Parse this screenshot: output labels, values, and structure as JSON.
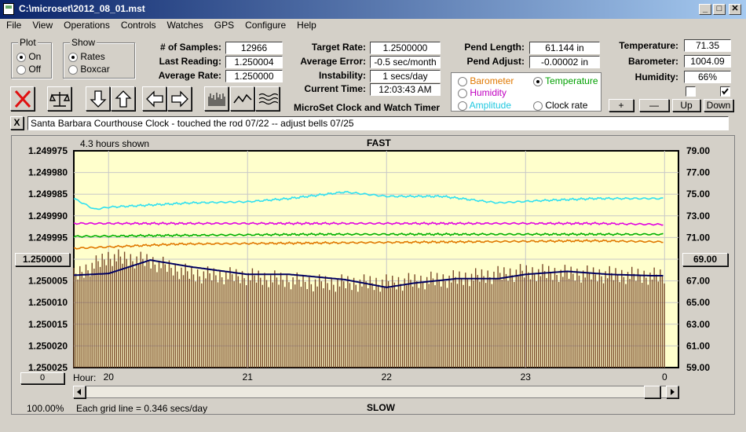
{
  "window": {
    "title": "C:\\microset\\2012_08_01.mst"
  },
  "menu": [
    "File",
    "View",
    "Operations",
    "Controls",
    "Watches",
    "GPS",
    "Configure",
    "Help"
  ],
  "plot_group": {
    "label": "Plot",
    "on": "On",
    "off": "Off",
    "selected": "On"
  },
  "show_group": {
    "label": "Show",
    "rates": "Rates",
    "boxcar": "Boxcar",
    "selected": "Rates"
  },
  "stats": {
    "samples_label": "# of Samples:",
    "samples": "12966",
    "last_reading_label": "Last Reading:",
    "last_reading": "1.250004",
    "average_rate_label": "Average Rate:",
    "average_rate": "1.250000",
    "target_rate_label": "Target Rate:",
    "target_rate": "1.2500000",
    "average_error_label": "Average Error:",
    "average_error": "-0.5 sec/month",
    "instability_label": "Instability:",
    "instability": "1 secs/day",
    "current_time_label": "Current Time:",
    "current_time": "12:03:43 AM",
    "pend_length_label": "Pend Length:",
    "pend_length": "61.144 in",
    "pend_adjust_label": "Pend Adjust:",
    "pend_adjust": "-0.00002 in",
    "temperature_label": "Temperature:",
    "temperature": "71.35",
    "barometer_label": "Barometer:",
    "barometer": "1004.09",
    "humidity_label": "Humidity:",
    "humidity": "66%"
  },
  "app_name": "MicroSet Clock and Watch Timer",
  "sensor_legend": {
    "barometer": "Barometer",
    "temperature": "Temperature",
    "humidity": "Humidity",
    "amplitude": "Amplitude",
    "clock_rate": "Clock rate",
    "selected": "Temperature"
  },
  "scale_buttons": {
    "plus": "+",
    "minus": "—",
    "up": "Up",
    "down": "Down"
  },
  "note": {
    "close": "X",
    "text": "Santa Barbara Courthouse Clock  -  touched the rod 07/22  --  adjust bells 07/25"
  },
  "chart_header": {
    "hours_shown": "4.3 hours shown",
    "top": "FAST",
    "bottom": "SLOW",
    "zoom": "100.00%",
    "grid_note": "Each grid line = 0.346 secs/day",
    "left_ref": "1.250000",
    "right_ref": "69.00",
    "scroll_value": "0"
  },
  "colors": {
    "temperature": "#00b000",
    "barometer": "#e07800",
    "humidity": "#e000e0",
    "amplitude": "#30e0f0",
    "clock_rate": "#000060",
    "bars": "#7a4a2a",
    "plot_bg": "#ffffcc"
  },
  "chart_data": {
    "type": "bar",
    "x_axis_label": "Hour:",
    "x_ticks": [
      "20",
      "21",
      "22",
      "23",
      "0"
    ],
    "left_axis": {
      "ticks": [
        "1.249975",
        "1.249980",
        "1.249985",
        "1.249990",
        "1.249995",
        "1.250000",
        "1.250005",
        "1.250010",
        "1.250015",
        "1.250020",
        "1.250025"
      ],
      "range": [
        1.249975,
        1.250025
      ],
      "inverted": true
    },
    "right_axis": {
      "ticks": [
        "79.00",
        "77.00",
        "75.00",
        "73.00",
        "71.00",
        "69.00",
        "67.00",
        "65.00",
        "63.00",
        "61.00",
        "59.00"
      ],
      "range": [
        59,
        79
      ]
    },
    "x_range": [
      19.75,
      24.1
    ],
    "data_end_hour": 24.0,
    "series": [
      {
        "name": "Amplitude",
        "color": "#30e0f0",
        "x": [
          19.75,
          19.9,
          20.0,
          20.3,
          20.6,
          21.0,
          21.3,
          21.7,
          22.0,
          22.4,
          22.8,
          23.1,
          23.5,
          23.8,
          24.0
        ],
        "y": [
          74.6,
          73.6,
          73.8,
          74.0,
          74.2,
          74.3,
          74.6,
          75.2,
          74.8,
          74.8,
          74.2,
          74.4,
          74.6,
          74.6,
          74.6
        ]
      },
      {
        "name": "Humidity",
        "color": "#e000e0",
        "x": [
          19.75,
          20.5,
          21.5,
          22.5,
          23.5,
          24.0
        ],
        "y": [
          72.3,
          72.3,
          72.3,
          72.3,
          72.3,
          72.2
        ]
      },
      {
        "name": "Temperature",
        "color": "#00b000",
        "x": [
          19.75,
          20.5,
          21.5,
          22.5,
          23.5,
          24.0
        ],
        "y": [
          71.1,
          71.2,
          71.3,
          71.3,
          71.3,
          71.3
        ]
      },
      {
        "name": "Barometer",
        "color": "#e07800",
        "x": [
          19.75,
          20.5,
          21.5,
          22.5,
          23.5,
          24.0
        ],
        "y": [
          70.0,
          70.4,
          70.5,
          70.6,
          70.7,
          70.6
        ]
      },
      {
        "name": "Boxcar",
        "color": "#000060",
        "x": [
          19.75,
          20.0,
          20.3,
          20.6,
          21.0,
          21.3,
          21.7,
          22.0,
          22.2,
          22.5,
          22.8,
          23.0,
          23.3,
          23.6,
          23.9,
          24.0
        ],
        "y": [
          1.2500037,
          1.2500033,
          1.2500002,
          1.2500018,
          1.2500035,
          1.2500035,
          1.2500047,
          1.2500065,
          1.2500055,
          1.2500045,
          1.2500045,
          1.2500035,
          1.2500028,
          1.2500035,
          1.2500038,
          1.2500038
        ]
      }
    ],
    "bars": {
      "start_hour": 19.75,
      "end_hour": 24.0,
      "base": 1.250025,
      "profile_x": [
        19.75,
        20.0,
        20.3,
        20.6,
        21.0,
        21.5,
        22.0,
        22.5,
        23.0,
        23.5,
        24.0
      ],
      "profile_y": [
        1.250004,
        1.2499995,
        1.2500005,
        1.2500035,
        1.250004,
        1.2500055,
        1.2500055,
        1.2500045,
        1.250003,
        1.2500035,
        1.250004
      ]
    }
  }
}
